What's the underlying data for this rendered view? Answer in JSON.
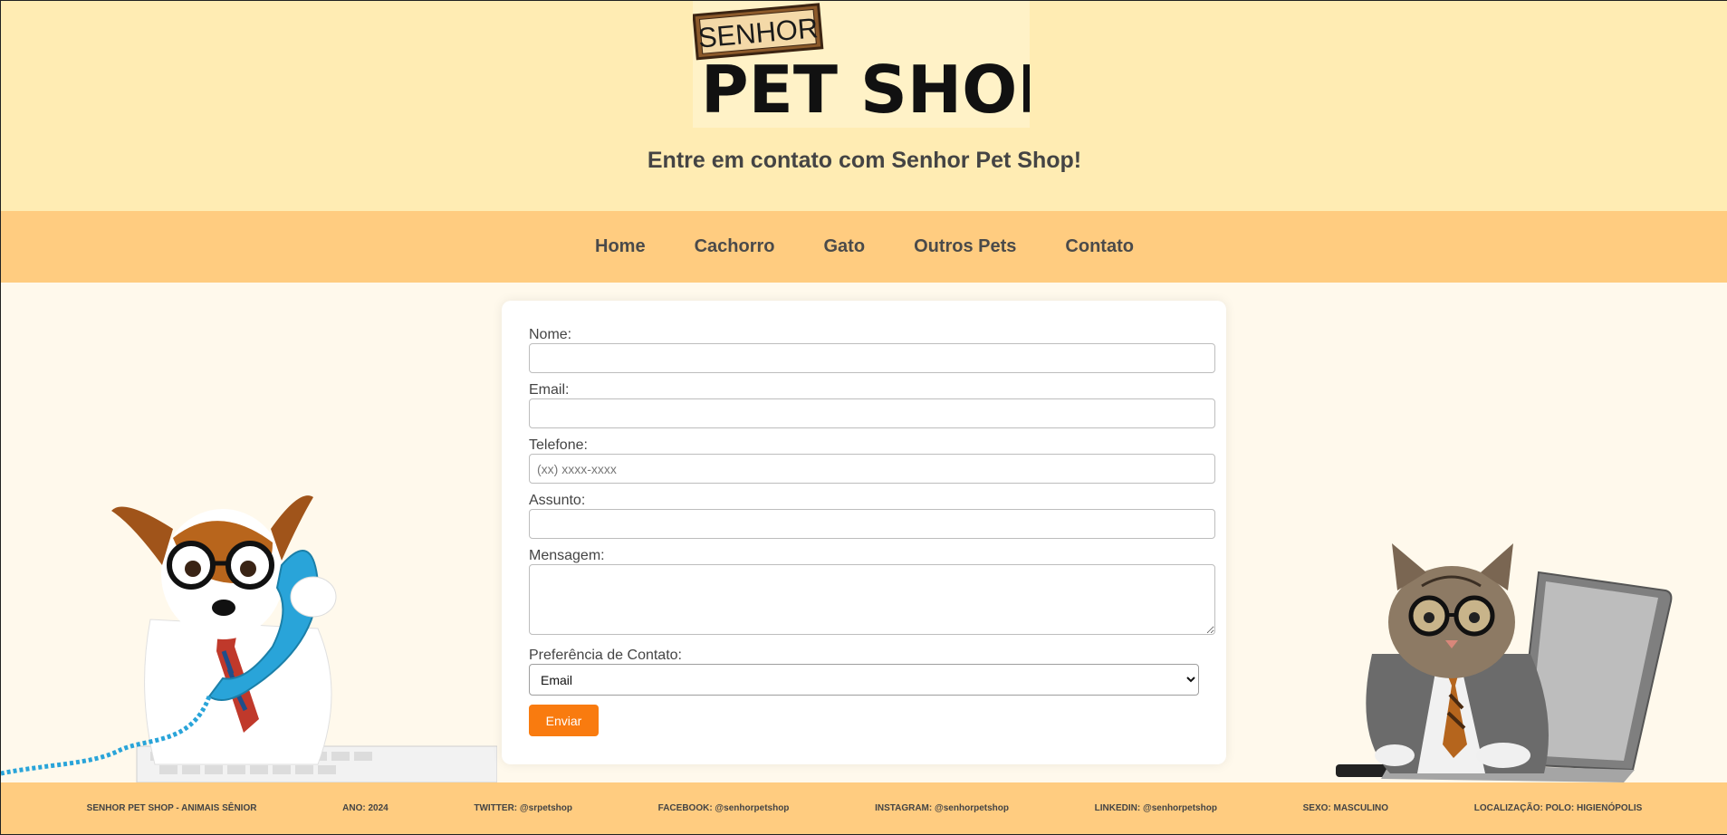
{
  "header": {
    "logo": {
      "top_text": "SENHOR",
      "main_text": "PET SHOP"
    },
    "tagline": "Entre em contato com Senhor Pet Shop!"
  },
  "nav": {
    "items": [
      {
        "label": "Home"
      },
      {
        "label": "Cachorro"
      },
      {
        "label": "Gato"
      },
      {
        "label": "Outros Pets"
      },
      {
        "label": "Contato"
      }
    ]
  },
  "form": {
    "name_label": "Nome:",
    "email_label": "Email:",
    "phone_label": "Telefone:",
    "phone_placeholder": "(xx) xxxx-xxxx",
    "subject_label": "Assunto:",
    "message_label": "Mensagem:",
    "preference_label": "Preferência de Contato:",
    "preference_selected": "Email",
    "submit_label": "Enviar"
  },
  "footer": {
    "items": [
      "SENHOR PET SHOP - ANIMAIS SÊNIOR",
      "ANO: 2024",
      "TWITTER: @srpetshop",
      "FACEBOOK: @senhorpetshop",
      "INSTAGRAM: @senhorpetshop",
      "LINKEDIN: @senhorpetshop",
      "SEXO: MASCULINO",
      "LOCALIZAÇÃO: POLO: HIGIENÓPOLIS"
    ]
  },
  "colors": {
    "header_bg": "#ffecb3",
    "nav_bg": "#ffcc80",
    "page_bg": "#fff9ec",
    "button_bg": "#f97b0f",
    "text": "#4a4a4a"
  },
  "images": {
    "left": "dog-with-phone",
    "right": "cat-with-laptop"
  }
}
